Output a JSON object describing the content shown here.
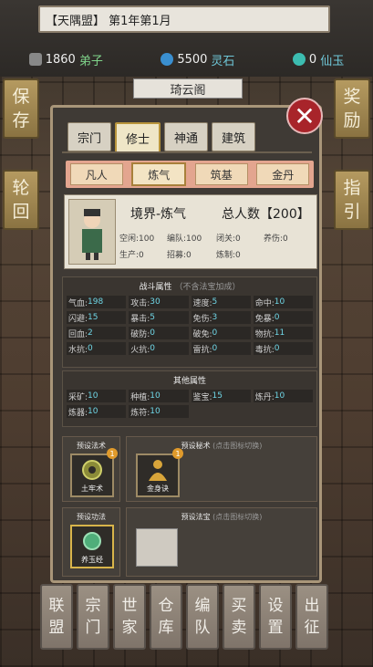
{
  "header": {
    "date": "【天隅盟】 第1年第1月"
  },
  "resources": [
    {
      "value": "1860",
      "label": "弟子",
      "icon": "disciple-icon",
      "color": "#7fd38a"
    },
    {
      "value": "5500",
      "label": "灵石",
      "icon": "spirit-stone-icon",
      "color": "#6fc7d8"
    },
    {
      "value": "0",
      "label": "仙玉",
      "icon": "immortal-jade-icon",
      "color": "#6fc7d8"
    }
  ],
  "left_buttons": [
    {
      "label1": "保",
      "label2": "存"
    },
    {
      "label1": "轮",
      "label2": "回"
    }
  ],
  "right_buttons": [
    {
      "label1": "奖",
      "label2": "励"
    },
    {
      "label1": "指",
      "label2": "引"
    }
  ],
  "panel": {
    "title": "琦云阁",
    "tabs": [
      "宗门",
      "修士",
      "神通",
      "建筑"
    ],
    "active_tab": "修士",
    "subtabs": [
      "凡人",
      "炼气",
      "筑基",
      "金丹"
    ],
    "active_subtab": "炼气",
    "info": {
      "realm": "境界-炼气",
      "total": "总人数【200】",
      "stats_row1": [
        "空闲:100",
        "编队:100",
        "闭关:0",
        "养伤:0"
      ],
      "stats_row2": [
        "生产:0",
        "招募:0",
        "炼制:0"
      ]
    },
    "combat": {
      "title": "战斗属性",
      "note": "（不含法宝加成）",
      "cells": [
        {
          "k": "气血:",
          "v": "198"
        },
        {
          "k": "攻击:",
          "v": "30"
        },
        {
          "k": "速度:",
          "v": "5"
        },
        {
          "k": "命中:",
          "v": "10"
        },
        {
          "k": "闪避:",
          "v": "15"
        },
        {
          "k": "暴击:",
          "v": "5"
        },
        {
          "k": "免伤:",
          "v": "3"
        },
        {
          "k": "免暴:",
          "v": "0"
        },
        {
          "k": "回血:",
          "v": "2"
        },
        {
          "k": "破防:",
          "v": "0"
        },
        {
          "k": "破免:",
          "v": "0"
        },
        {
          "k": "物抗:",
          "v": "11"
        },
        {
          "k": "水抗:",
          "v": "0"
        },
        {
          "k": "火抗:",
          "v": "0"
        },
        {
          "k": "雷抗:",
          "v": "0"
        },
        {
          "k": "毒抗:",
          "v": "0"
        }
      ]
    },
    "other": {
      "title": "其他属性",
      "cells": [
        {
          "k": "采矿:",
          "v": "10"
        },
        {
          "k": "种植:",
          "v": "10"
        },
        {
          "k": "鉴宝:",
          "v": "15"
        },
        {
          "k": "炼丹:",
          "v": "10"
        },
        {
          "k": "炼器:",
          "v": "10"
        },
        {
          "k": "炼符:",
          "v": "10"
        }
      ]
    },
    "preset_magic": {
      "label": "预设法术",
      "skill": "土牢术",
      "badge": "1"
    },
    "preset_secret": {
      "label": "预设秘术",
      "note": "(点击图标切换)",
      "skill": "金身诀",
      "badge": "1"
    },
    "preset_method": {
      "label": "预设功法",
      "skill": "养玉经"
    },
    "preset_treasure": {
      "label": "预设法宝",
      "note": "(点击图标切换)"
    }
  },
  "bottom_buttons": [
    {
      "a": "联",
      "b": "盟"
    },
    {
      "a": "宗",
      "b": "门"
    },
    {
      "a": "世",
      "b": "家"
    },
    {
      "a": "仓",
      "b": "库"
    },
    {
      "a": "编",
      "b": "队"
    },
    {
      "a": "买",
      "b": "卖"
    },
    {
      "a": "设",
      "b": "置"
    },
    {
      "a": "出",
      "b": "征"
    }
  ]
}
